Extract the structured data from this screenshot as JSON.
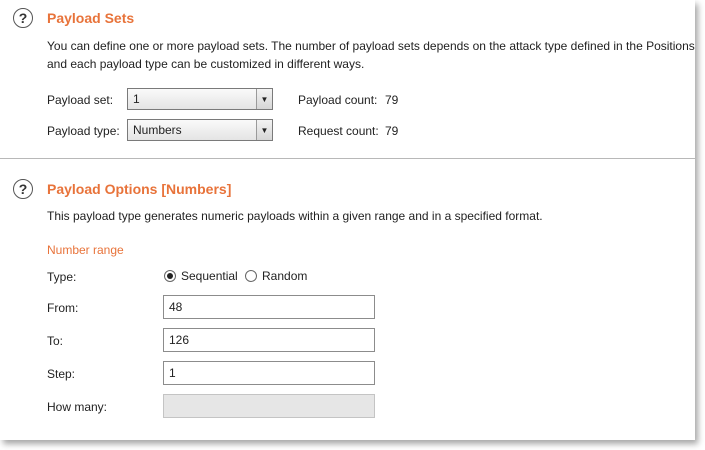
{
  "payload_sets": {
    "title": "Payload Sets",
    "description_line1": "You can define one or more payload sets. The number of payload sets depends on the attack type defined in the Positions",
    "description_line2": "and each payload type can be customized in different ways.",
    "set_label": "Payload set:",
    "set_value": "1",
    "type_label": "Payload type:",
    "type_value": "Numbers",
    "payload_count_label": "Payload count:",
    "payload_count": "79",
    "request_count_label": "Request count:",
    "request_count": "79"
  },
  "payload_options": {
    "title": "Payload Options [Numbers]",
    "description": "This payload type generates numeric payloads within a given range and in a specified format.",
    "number_range_label": "Number range",
    "type_label": "Type:",
    "sequential_label": "Sequential",
    "random_label": "Random",
    "selected_type": "Sequential",
    "from_label": "From:",
    "from_value": "48",
    "to_label": "To:",
    "to_value": "126",
    "step_label": "Step:",
    "step_value": "1",
    "how_many_label": "How many:",
    "how_many_value": ""
  },
  "icons": {
    "help": "help-icon",
    "dropdown": "chevron-down-icon"
  },
  "colors": {
    "accent": "#e8733a"
  }
}
